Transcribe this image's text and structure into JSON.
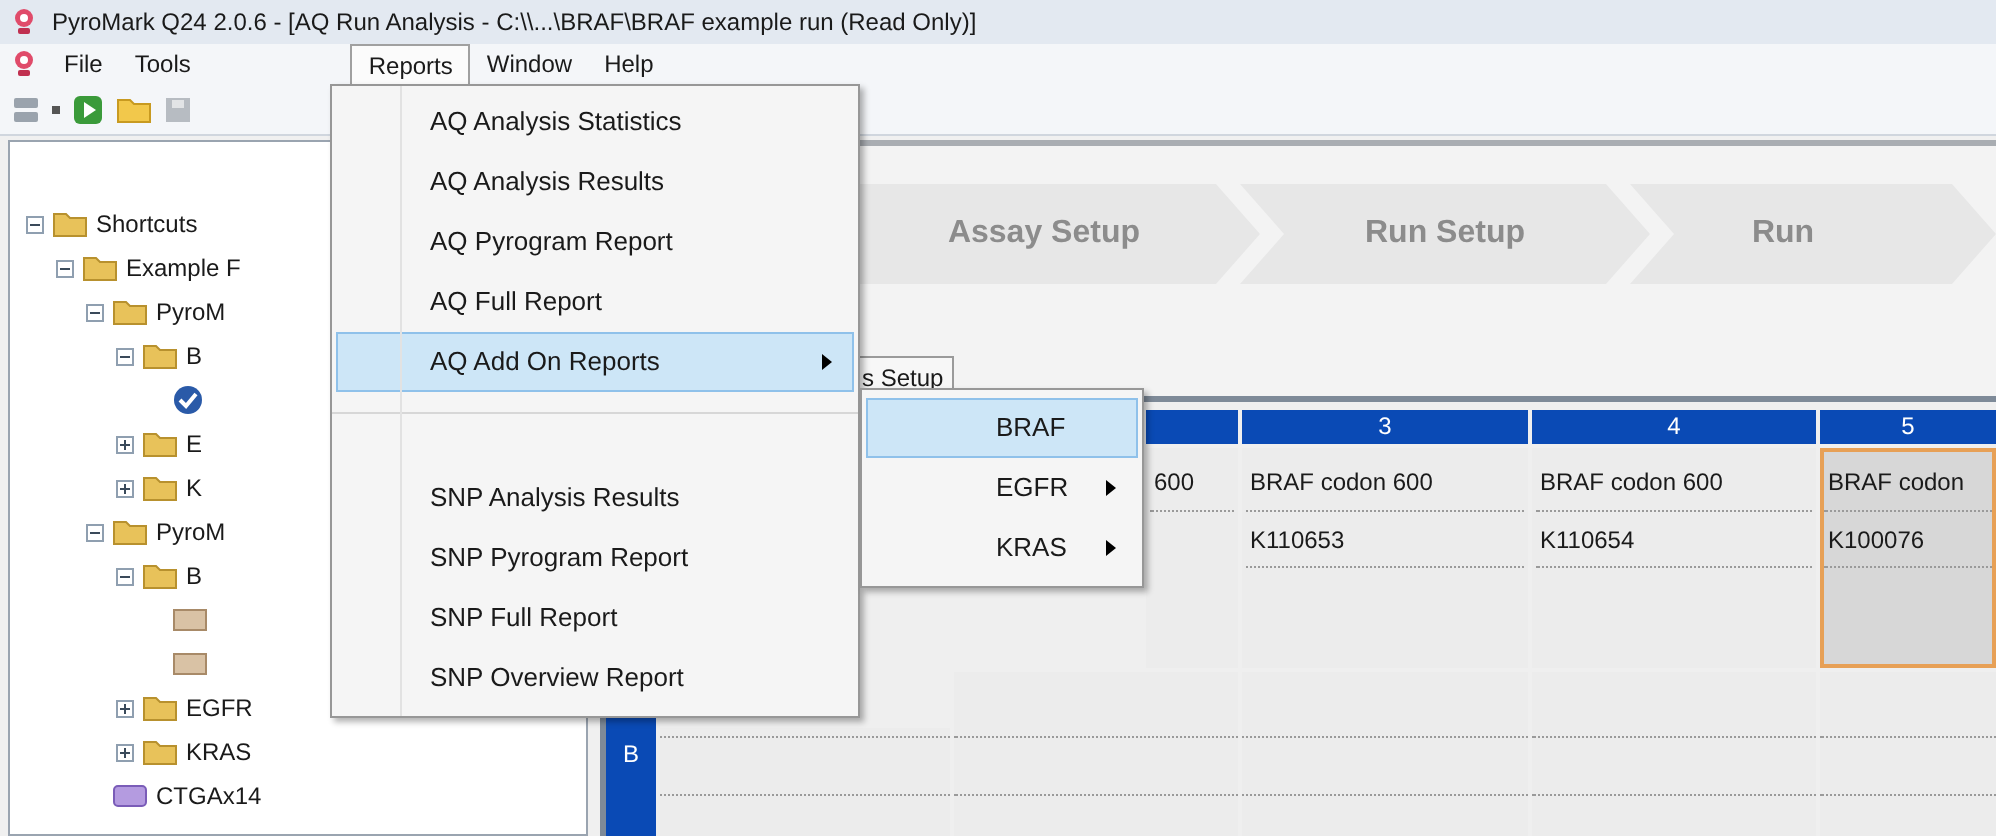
{
  "window": {
    "title": "PyroMark Q24 2.0.6 - [AQ Run Analysis - C:\\\\...\\BRAF\\BRAF example run (Read Only)]"
  },
  "menubar": [
    {
      "label": "File",
      "selected": false
    },
    {
      "label": "Tools",
      "selected": false
    },
    {
      "label": "Reports",
      "selected": true
    },
    {
      "label": "Window",
      "selected": false
    },
    {
      "label": "Help",
      "selected": false
    }
  ],
  "tree": [
    {
      "label": "Shortcuts",
      "kind": "folder",
      "expanded": true,
      "children": [
        {
          "label": "Example F",
          "kind": "folder",
          "expanded": true,
          "children": [
            {
              "label": "PyroM",
              "kind": "folder",
              "expanded": true,
              "children": [
                {
                  "label": "B",
                  "kind": "folder",
                  "expanded": true,
                  "children": [
                    {
                      "kind": "run"
                    }
                  ]
                },
                {
                  "label": "E",
                  "kind": "folder",
                  "expanded": false
                },
                {
                  "label": "K",
                  "kind": "folder",
                  "expanded": false
                }
              ]
            },
            {
              "label": "PyroM",
              "kind": "folder",
              "expanded": true,
              "children": [
                {
                  "label": "B",
                  "kind": "folder",
                  "expanded": true,
                  "children": [
                    {
                      "kind": "file"
                    },
                    {
                      "kind": "file"
                    }
                  ]
                },
                {
                  "label": "EGFR",
                  "kind": "folder",
                  "expanded": false
                },
                {
                  "label": "KRAS",
                  "kind": "folder",
                  "expanded": false
                }
              ]
            },
            {
              "label": "CTGAx14",
              "kind": "assay"
            }
          ]
        }
      ]
    }
  ],
  "steps": [
    {
      "label": "Assay Setup"
    },
    {
      "label": "Run Setup"
    },
    {
      "label": "Run"
    }
  ],
  "tab": {
    "label": "s Setup"
  },
  "plate": {
    "columns": [
      "3",
      "4",
      "5"
    ],
    "rows": [
      {
        "cells": [
          {
            "assay": "600",
            "selected": false
          },
          {
            "assay": "BRAF codon 600",
            "sample": "K110653",
            "selected": false
          },
          {
            "assay": "BRAF codon 600",
            "sample": "K110654",
            "selected": false
          },
          {
            "assay": "BRAF codon",
            "sample": "K100076",
            "selected": true
          }
        ]
      },
      {
        "label": "B"
      }
    ]
  },
  "reports_menu": [
    {
      "kind": "item",
      "label": "AQ Analysis Statistics",
      "selected": false,
      "submenu": false
    },
    {
      "kind": "item",
      "label": "AQ Analysis Results",
      "selected": false,
      "submenu": false
    },
    {
      "kind": "item",
      "label": "AQ Pyrogram Report",
      "selected": false,
      "submenu": false
    },
    {
      "kind": "item",
      "label": "AQ Full Report",
      "selected": false,
      "submenu": false
    },
    {
      "kind": "item",
      "label": "AQ Add On Reports",
      "selected": true,
      "submenu": true
    },
    {
      "kind": "separator"
    },
    {
      "kind": "item",
      "label": "SNP Analysis Results",
      "selected": false,
      "submenu": false
    },
    {
      "kind": "item",
      "label": "SNP Pyrogram Report",
      "selected": false,
      "submenu": false
    },
    {
      "kind": "item",
      "label": "SNP Full Report",
      "selected": false,
      "submenu": false
    },
    {
      "kind": "item",
      "label": "SNP Overview Report",
      "selected": false,
      "submenu": false
    }
  ],
  "add_on_submenu": [
    {
      "kind": "item",
      "label": "BRAF",
      "selected": true,
      "submenu": false
    },
    {
      "kind": "item",
      "label": "EGFR",
      "selected": false,
      "submenu": true
    },
    {
      "kind": "item",
      "label": "KRAS",
      "selected": false,
      "submenu": true
    }
  ]
}
